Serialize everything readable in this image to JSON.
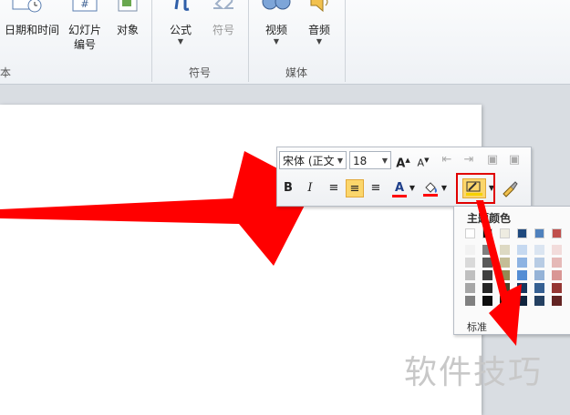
{
  "ribbon": {
    "datetime_label": "日期和时间",
    "slide_number_line1": "幻灯片",
    "slide_number_line2": "编号",
    "object_label": "对象",
    "equation_label": "公式",
    "symbol_label": "符号",
    "video_label": "视频",
    "audio_label": "音频",
    "group_text_label": "本",
    "group_symbols_label": "符号",
    "group_media_label": "媒体",
    "slide_number_icon_glyph": "#"
  },
  "mini_toolbar": {
    "font_name": "宋体 (正文",
    "font_size": "18",
    "grow_font": "A",
    "shrink_font": "A",
    "bold": "B",
    "italic": "I",
    "font_color_glyph": "A"
  },
  "color_panel": {
    "title": "主题颜色",
    "partial_label": "标准",
    "theme_colors": [
      "#ffffff",
      "#000000",
      "#eeece1",
      "#1f497d",
      "#4f81bd",
      "#c0504d"
    ],
    "tint_columns": [
      [
        "#f2f2f2",
        "#d9d9d9",
        "#bfbfbf",
        "#a6a6a6",
        "#808080"
      ],
      [
        "#7f7f7f",
        "#595959",
        "#3f3f3f",
        "#262626",
        "#0d0d0d"
      ],
      [
        "#ddd9c3",
        "#c4bd97",
        "#938953",
        "#494429",
        "#1d1b10"
      ],
      [
        "#c6d9f0",
        "#8db3e2",
        "#548dd4",
        "#17365d",
        "#0f243e"
      ],
      [
        "#dbe5f1",
        "#b8cce4",
        "#95b3d7",
        "#366092",
        "#244061"
      ],
      [
        "#f2dcdb",
        "#e5b9b7",
        "#d99694",
        "#953734",
        "#632423"
      ]
    ]
  },
  "watermark": "软件技巧",
  "colors": {
    "arrow": "#ff0000",
    "highlight": "#e00000",
    "active_button": "#fbd66b",
    "font_color_underline": "#ff0000"
  }
}
